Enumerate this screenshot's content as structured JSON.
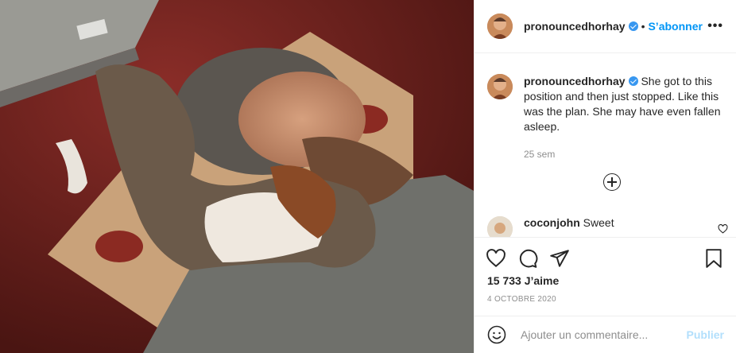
{
  "post": {
    "image_alt": "Photo",
    "author": {
      "username": "pronouncedhorhay",
      "verified": true,
      "follow_label": "S’abonner",
      "separator": "•"
    },
    "more_label": "•••",
    "caption": {
      "username": "pronouncedhorhay",
      "text": "She got to this position and then just stopped. Like this was the plan. She may have even fallen asleep.",
      "time": "25 sem"
    },
    "comments": [
      {
        "username": "coconjohn",
        "text": "Sweet"
      }
    ],
    "likes": "15 733 J’aime",
    "date": "4 OCTOBRE 2020",
    "add_comment": {
      "placeholder": "Ajouter un commentaire...",
      "publish_label": "Publier"
    }
  },
  "colors": {
    "accent": "#0095f6",
    "verified": "#3897f0",
    "publish_disabled": "#b2dffc",
    "border": "#efefef",
    "muted": "#8e8e8e"
  },
  "icons": [
    "heart-icon",
    "comment-icon",
    "share-icon",
    "bookmark-icon",
    "emoji-icon",
    "plus-circle-icon",
    "more-icon",
    "verified-icon"
  ]
}
